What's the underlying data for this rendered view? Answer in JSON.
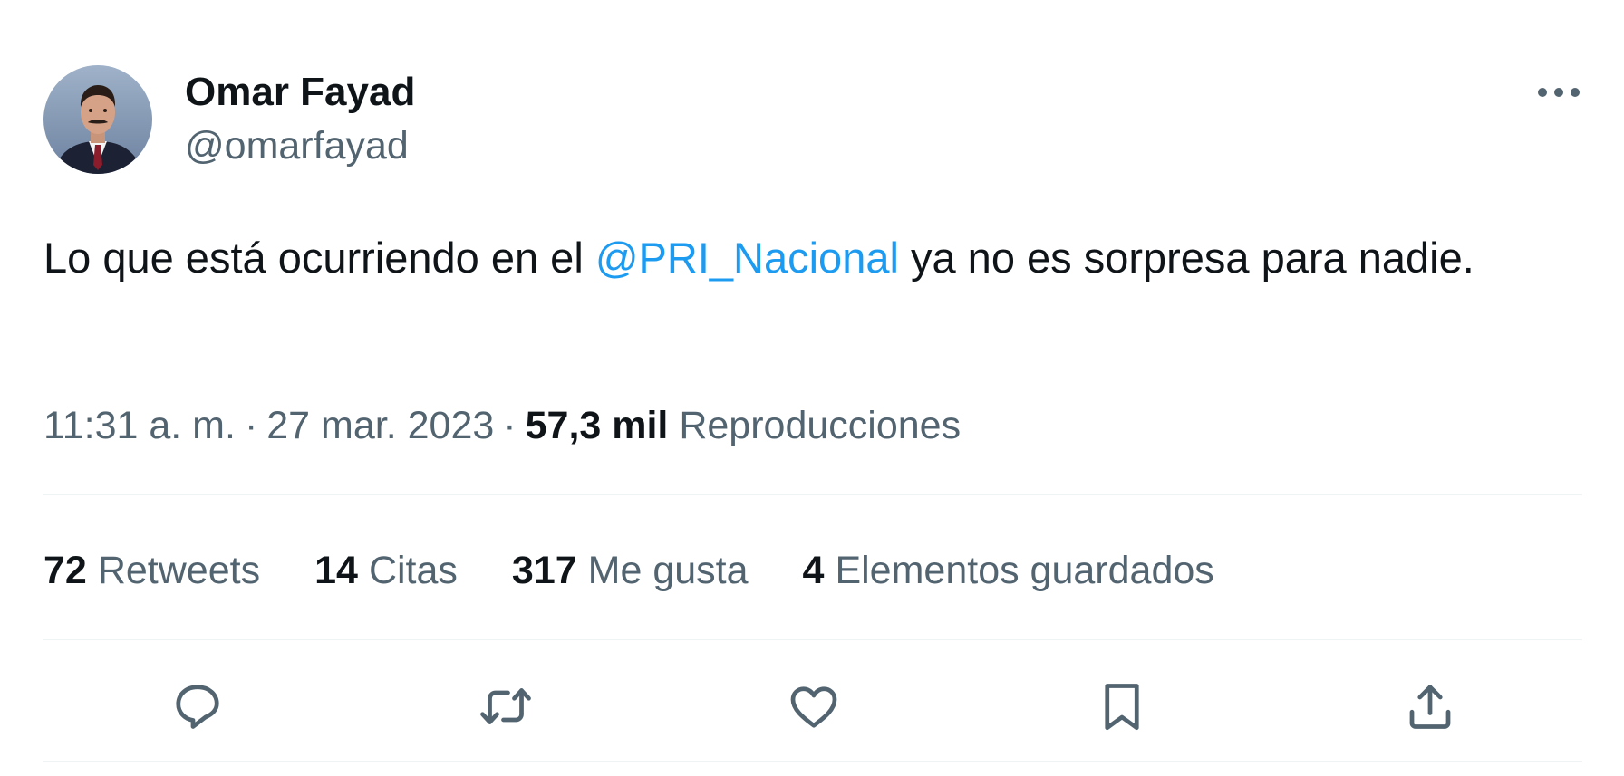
{
  "author": {
    "display_name": "Omar Fayad",
    "handle": "@omarfayad"
  },
  "tweet": {
    "text_before": "Lo que está ocurriendo en el ",
    "mention": "@PRI_Nacional",
    "text_after": " ya no es sorpresa para nadie."
  },
  "meta": {
    "time": "11:31 a. m.",
    "separator": "·",
    "date": "27 mar. 2023",
    "views_count": "57,3 mil",
    "views_label": "Reproducciones"
  },
  "stats": [
    {
      "count": "72",
      "label": "Retweets"
    },
    {
      "count": "14",
      "label": "Citas"
    },
    {
      "count": "317",
      "label": "Me gusta"
    },
    {
      "count": "4",
      "label": "Elementos guardados"
    }
  ],
  "actions": {
    "reply_icon": "reply-icon",
    "retweet_icon": "retweet-icon",
    "like_icon": "heart-icon",
    "bookmark_icon": "bookmark-icon",
    "share_icon": "share-icon"
  },
  "colors": {
    "text_primary": "#0f1419",
    "text_secondary": "#536471",
    "link": "#1d9bf0",
    "divider": "#eff3f4"
  }
}
